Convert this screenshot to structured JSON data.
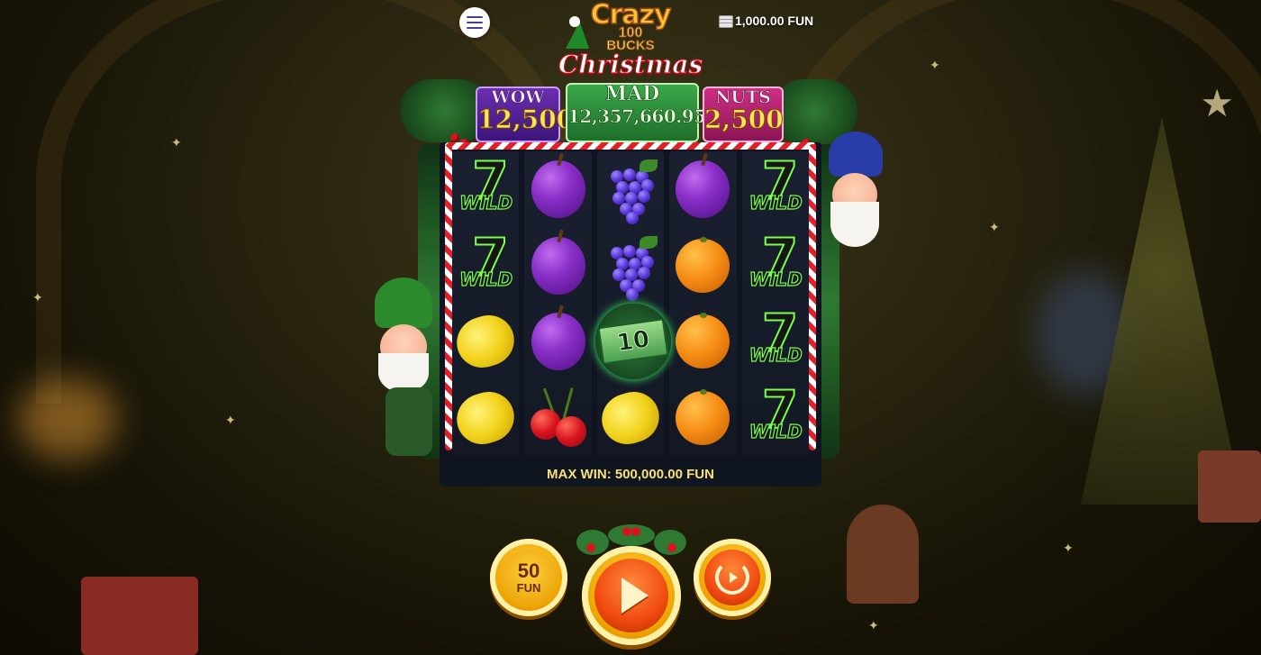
{
  "header": {
    "menu_icon": "hamburger-menu-icon",
    "balance": "1,000.00 FUN",
    "balance_icon": "coin-stack-icon"
  },
  "logo": {
    "line1": "Crazy",
    "line2": "100",
    "line3": "BUCKS",
    "line4": "Christmas"
  },
  "jackpots": {
    "wow": {
      "label": "WOW",
      "value": "12,500"
    },
    "mad": {
      "label": "MAD",
      "value": "12,357,660.95"
    },
    "nuts": {
      "label": "NUTS",
      "value": "2,500"
    }
  },
  "reels": [
    [
      "wild",
      "wild",
      "lemon",
      "lemon"
    ],
    [
      "plum",
      "plum",
      "plum",
      "cherry"
    ],
    [
      "grapes",
      "grapes",
      "money",
      "lemon"
    ],
    [
      "plum",
      "orange",
      "orange",
      "orange"
    ],
    [
      "wild",
      "wild",
      "wild",
      "wild"
    ]
  ],
  "symbols": {
    "wild_seven": "7",
    "wild_text": "WILD",
    "money_value": "10"
  },
  "max_win": "MAX WIN: 500,000.00 FUN",
  "controls": {
    "bet_amount": "50",
    "bet_currency": "FUN",
    "spin_icon": "play-icon",
    "autoplay_icon": "autoplay-icon"
  },
  "colors": {
    "wild_outline": "#7aff4a",
    "button_gold": "#f0a400",
    "button_orange": "#f04a10",
    "max_win_text": "#f6e07a"
  }
}
